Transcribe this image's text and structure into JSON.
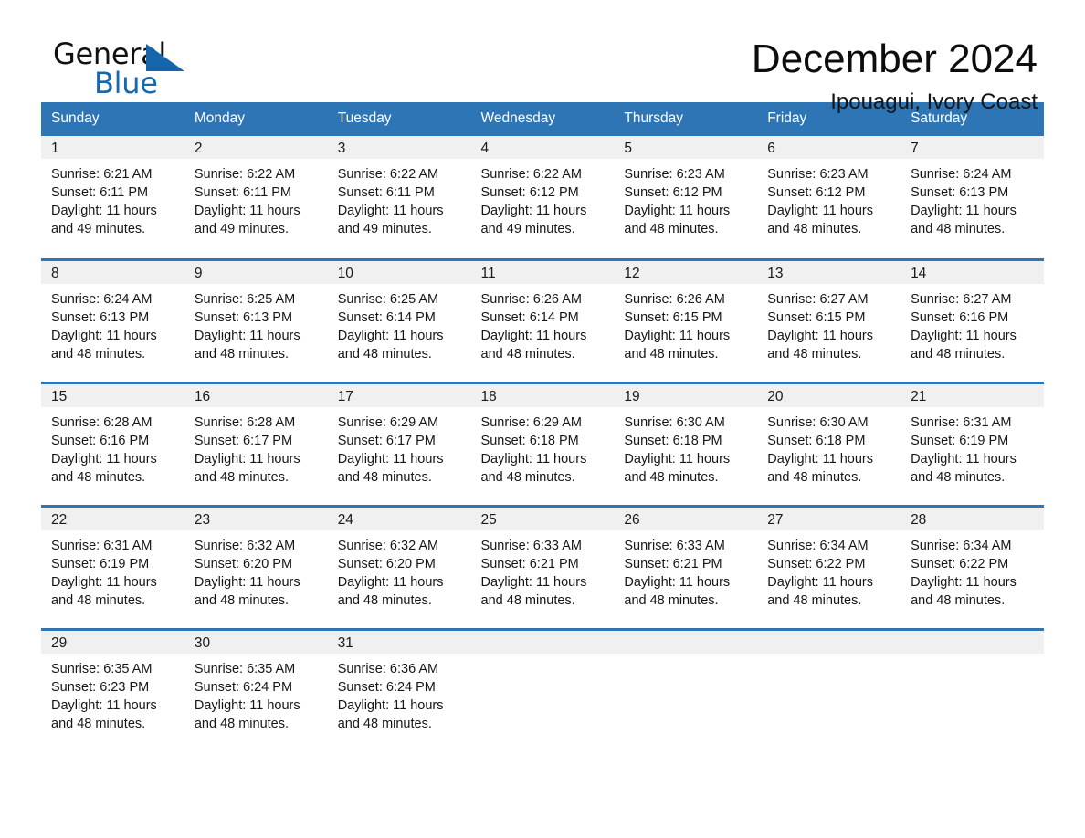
{
  "brand": {
    "name_top": "General",
    "name_bottom": "Blue",
    "triangle_color": "#1565ad",
    "blue_color": "#1668b0"
  },
  "header": {
    "month_title": "December 2024",
    "location": "Ipouagui, Ivory Coast"
  },
  "theme": {
    "header_bg": "#2e75b6",
    "header_text": "#ffffff",
    "row_divider": "#2e75b6",
    "daynum_band_bg": "#f0f0f0",
    "page_bg": "#ffffff",
    "body_text": "#161616"
  },
  "calendar": {
    "weekday_headers": [
      "Sunday",
      "Monday",
      "Tuesday",
      "Wednesday",
      "Thursday",
      "Friday",
      "Saturday"
    ],
    "weeks": [
      [
        {
          "day": "1",
          "sunrise": "Sunrise: 6:21 AM",
          "sunset": "Sunset: 6:11 PM",
          "daylight_line1": "Daylight: 11 hours",
          "daylight_line2": "and 49 minutes."
        },
        {
          "day": "2",
          "sunrise": "Sunrise: 6:22 AM",
          "sunset": "Sunset: 6:11 PM",
          "daylight_line1": "Daylight: 11 hours",
          "daylight_line2": "and 49 minutes."
        },
        {
          "day": "3",
          "sunrise": "Sunrise: 6:22 AM",
          "sunset": "Sunset: 6:11 PM",
          "daylight_line1": "Daylight: 11 hours",
          "daylight_line2": "and 49 minutes."
        },
        {
          "day": "4",
          "sunrise": "Sunrise: 6:22 AM",
          "sunset": "Sunset: 6:12 PM",
          "daylight_line1": "Daylight: 11 hours",
          "daylight_line2": "and 49 minutes."
        },
        {
          "day": "5",
          "sunrise": "Sunrise: 6:23 AM",
          "sunset": "Sunset: 6:12 PM",
          "daylight_line1": "Daylight: 11 hours",
          "daylight_line2": "and 48 minutes."
        },
        {
          "day": "6",
          "sunrise": "Sunrise: 6:23 AM",
          "sunset": "Sunset: 6:12 PM",
          "daylight_line1": "Daylight: 11 hours",
          "daylight_line2": "and 48 minutes."
        },
        {
          "day": "7",
          "sunrise": "Sunrise: 6:24 AM",
          "sunset": "Sunset: 6:13 PM",
          "daylight_line1": "Daylight: 11 hours",
          "daylight_line2": "and 48 minutes."
        }
      ],
      [
        {
          "day": "8",
          "sunrise": "Sunrise: 6:24 AM",
          "sunset": "Sunset: 6:13 PM",
          "daylight_line1": "Daylight: 11 hours",
          "daylight_line2": "and 48 minutes."
        },
        {
          "day": "9",
          "sunrise": "Sunrise: 6:25 AM",
          "sunset": "Sunset: 6:13 PM",
          "daylight_line1": "Daylight: 11 hours",
          "daylight_line2": "and 48 minutes."
        },
        {
          "day": "10",
          "sunrise": "Sunrise: 6:25 AM",
          "sunset": "Sunset: 6:14 PM",
          "daylight_line1": "Daylight: 11 hours",
          "daylight_line2": "and 48 minutes."
        },
        {
          "day": "11",
          "sunrise": "Sunrise: 6:26 AM",
          "sunset": "Sunset: 6:14 PM",
          "daylight_line1": "Daylight: 11 hours",
          "daylight_line2": "and 48 minutes."
        },
        {
          "day": "12",
          "sunrise": "Sunrise: 6:26 AM",
          "sunset": "Sunset: 6:15 PM",
          "daylight_line1": "Daylight: 11 hours",
          "daylight_line2": "and 48 minutes."
        },
        {
          "day": "13",
          "sunrise": "Sunrise: 6:27 AM",
          "sunset": "Sunset: 6:15 PM",
          "daylight_line1": "Daylight: 11 hours",
          "daylight_line2": "and 48 minutes."
        },
        {
          "day": "14",
          "sunrise": "Sunrise: 6:27 AM",
          "sunset": "Sunset: 6:16 PM",
          "daylight_line1": "Daylight: 11 hours",
          "daylight_line2": "and 48 minutes."
        }
      ],
      [
        {
          "day": "15",
          "sunrise": "Sunrise: 6:28 AM",
          "sunset": "Sunset: 6:16 PM",
          "daylight_line1": "Daylight: 11 hours",
          "daylight_line2": "and 48 minutes."
        },
        {
          "day": "16",
          "sunrise": "Sunrise: 6:28 AM",
          "sunset": "Sunset: 6:17 PM",
          "daylight_line1": "Daylight: 11 hours",
          "daylight_line2": "and 48 minutes."
        },
        {
          "day": "17",
          "sunrise": "Sunrise: 6:29 AM",
          "sunset": "Sunset: 6:17 PM",
          "daylight_line1": "Daylight: 11 hours",
          "daylight_line2": "and 48 minutes."
        },
        {
          "day": "18",
          "sunrise": "Sunrise: 6:29 AM",
          "sunset": "Sunset: 6:18 PM",
          "daylight_line1": "Daylight: 11 hours",
          "daylight_line2": "and 48 minutes."
        },
        {
          "day": "19",
          "sunrise": "Sunrise: 6:30 AM",
          "sunset": "Sunset: 6:18 PM",
          "daylight_line1": "Daylight: 11 hours",
          "daylight_line2": "and 48 minutes."
        },
        {
          "day": "20",
          "sunrise": "Sunrise: 6:30 AM",
          "sunset": "Sunset: 6:18 PM",
          "daylight_line1": "Daylight: 11 hours",
          "daylight_line2": "and 48 minutes."
        },
        {
          "day": "21",
          "sunrise": "Sunrise: 6:31 AM",
          "sunset": "Sunset: 6:19 PM",
          "daylight_line1": "Daylight: 11 hours",
          "daylight_line2": "and 48 minutes."
        }
      ],
      [
        {
          "day": "22",
          "sunrise": "Sunrise: 6:31 AM",
          "sunset": "Sunset: 6:19 PM",
          "daylight_line1": "Daylight: 11 hours",
          "daylight_line2": "and 48 minutes."
        },
        {
          "day": "23",
          "sunrise": "Sunrise: 6:32 AM",
          "sunset": "Sunset: 6:20 PM",
          "daylight_line1": "Daylight: 11 hours",
          "daylight_line2": "and 48 minutes."
        },
        {
          "day": "24",
          "sunrise": "Sunrise: 6:32 AM",
          "sunset": "Sunset: 6:20 PM",
          "daylight_line1": "Daylight: 11 hours",
          "daylight_line2": "and 48 minutes."
        },
        {
          "day": "25",
          "sunrise": "Sunrise: 6:33 AM",
          "sunset": "Sunset: 6:21 PM",
          "daylight_line1": "Daylight: 11 hours",
          "daylight_line2": "and 48 minutes."
        },
        {
          "day": "26",
          "sunrise": "Sunrise: 6:33 AM",
          "sunset": "Sunset: 6:21 PM",
          "daylight_line1": "Daylight: 11 hours",
          "daylight_line2": "and 48 minutes."
        },
        {
          "day": "27",
          "sunrise": "Sunrise: 6:34 AM",
          "sunset": "Sunset: 6:22 PM",
          "daylight_line1": "Daylight: 11 hours",
          "daylight_line2": "and 48 minutes."
        },
        {
          "day": "28",
          "sunrise": "Sunrise: 6:34 AM",
          "sunset": "Sunset: 6:22 PM",
          "daylight_line1": "Daylight: 11 hours",
          "daylight_line2": "and 48 minutes."
        }
      ],
      [
        {
          "day": "29",
          "sunrise": "Sunrise: 6:35 AM",
          "sunset": "Sunset: 6:23 PM",
          "daylight_line1": "Daylight: 11 hours",
          "daylight_line2": "and 48 minutes."
        },
        {
          "day": "30",
          "sunrise": "Sunrise: 6:35 AM",
          "sunset": "Sunset: 6:24 PM",
          "daylight_line1": "Daylight: 11 hours",
          "daylight_line2": "and 48 minutes."
        },
        {
          "day": "31",
          "sunrise": "Sunrise: 6:36 AM",
          "sunset": "Sunset: 6:24 PM",
          "daylight_line1": "Daylight: 11 hours",
          "daylight_line2": "and 48 minutes."
        },
        {
          "day": "",
          "sunrise": "",
          "sunset": "",
          "daylight_line1": "",
          "daylight_line2": ""
        },
        {
          "day": "",
          "sunrise": "",
          "sunset": "",
          "daylight_line1": "",
          "daylight_line2": ""
        },
        {
          "day": "",
          "sunrise": "",
          "sunset": "",
          "daylight_line1": "",
          "daylight_line2": ""
        },
        {
          "day": "",
          "sunrise": "",
          "sunset": "",
          "daylight_line1": "",
          "daylight_line2": ""
        }
      ]
    ]
  }
}
